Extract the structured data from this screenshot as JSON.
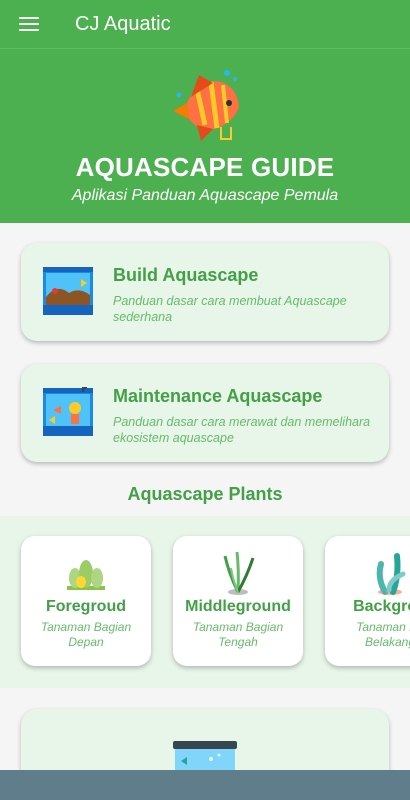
{
  "app": {
    "title": "CJ Aquatic"
  },
  "hero": {
    "title": "AQUASCAPE GUIDE",
    "subtitle": "Aplikasi Panduan Aquascape Pemula",
    "icon": "angelfish-icon"
  },
  "menu_cards": [
    {
      "title": "Build Aquascape",
      "description": "Panduan dasar cara membuat Aquascape sederhana",
      "icon": "aquarium-build-icon"
    },
    {
      "title": "Maintenance Aquascape",
      "description": "Panduan dasar cara merawat dan memelihara ekosistem aquascape",
      "icon": "diver-aquarium-icon"
    }
  ],
  "plants": {
    "section_title": "Aquascape Plants",
    "items": [
      {
        "name": "Foregroud",
        "description": "Tanaman Bagian Depan",
        "icon": "foreground-plant-icon"
      },
      {
        "name": "Middleground",
        "description": "Tanaman Bagian Tengah",
        "icon": "middleground-plant-icon"
      },
      {
        "name": "Backgrou",
        "description": "Tanaman Ba Belakang",
        "icon": "background-plant-icon"
      }
    ]
  },
  "colors": {
    "primary": "#4caf50",
    "accent_text": "#43a047",
    "card_bg": "#e8f5e9",
    "nav_bar": "#607d8b"
  }
}
